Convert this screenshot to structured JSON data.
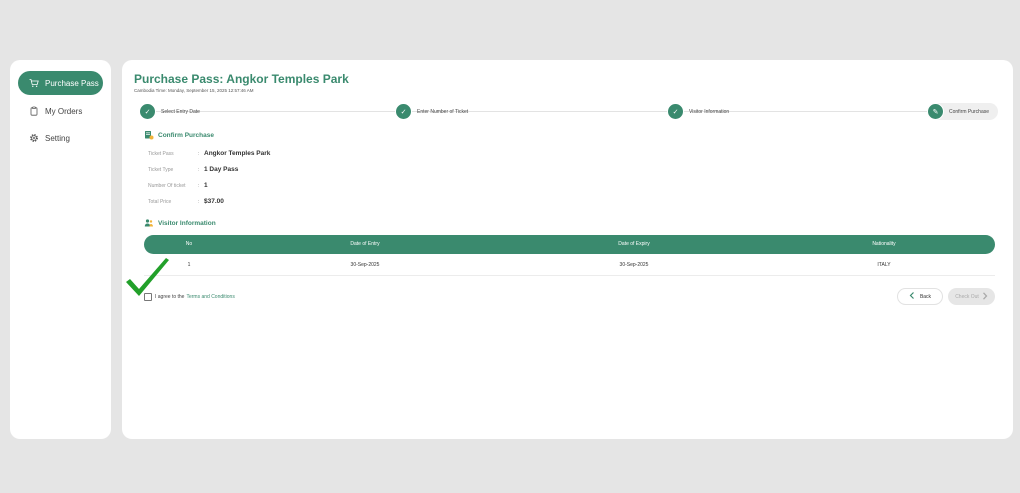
{
  "sidebar": {
    "items": [
      {
        "label": "Purchase Pass",
        "icon": "cart-icon",
        "active": true
      },
      {
        "label": "My Orders",
        "icon": "clipboard-icon",
        "active": false
      },
      {
        "label": "Setting",
        "icon": "gear-icon",
        "active": false
      }
    ]
  },
  "header": {
    "title": "Purchase Pass: Angkor Temples Park",
    "subtitle": "Cambodia Time: Monday, September 15, 2025 12:57:46 AM"
  },
  "steps": [
    {
      "label": "Select Entry Date",
      "state": "done"
    },
    {
      "label": "Enter Number of Ticket",
      "state": "done"
    },
    {
      "label": "Visitor Information",
      "state": "done"
    },
    {
      "label": "Confirm Purchase",
      "state": "current"
    }
  ],
  "confirm": {
    "title": "Confirm Purchase",
    "rows": [
      {
        "label": "Ticket Pass",
        "value": "Angkor Temples Park"
      },
      {
        "label": "Ticket Type",
        "value": "1 Day Pass"
      },
      {
        "label": "Number Of ticket",
        "value": "1"
      },
      {
        "label": "Total Price",
        "value": "$37.00"
      }
    ]
  },
  "visitor": {
    "title": "Visitor Information",
    "columns": [
      "No",
      "Date of Entry",
      "Date of Expiry",
      "Nationality"
    ],
    "rows": [
      [
        "1",
        "30-Sep-2025",
        "30-Sep-2025",
        "ITALY"
      ]
    ]
  },
  "agree": {
    "prefix": "I agree to the",
    "link": "Terms and Conditions",
    "checked": false
  },
  "buttons": {
    "back": "Back",
    "checkout": "Check Out"
  },
  "colors": {
    "accent": "#3a8a6e",
    "background": "#e5e5e5",
    "checkmark": "#22a02a"
  }
}
